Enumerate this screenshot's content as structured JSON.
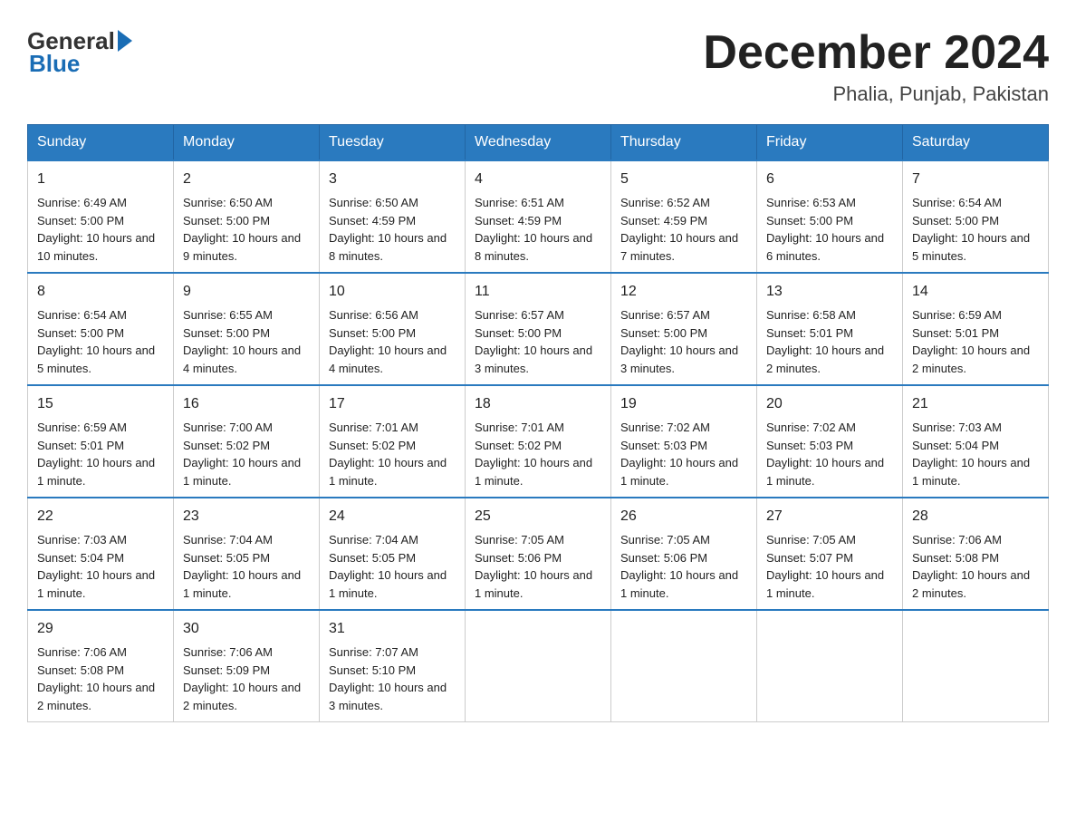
{
  "logo": {
    "general": "General",
    "blue": "Blue"
  },
  "title": "December 2024",
  "location": "Phalia, Punjab, Pakistan",
  "days_of_week": [
    "Sunday",
    "Monday",
    "Tuesday",
    "Wednesday",
    "Thursday",
    "Friday",
    "Saturday"
  ],
  "weeks": [
    [
      {
        "date": "1",
        "sunrise": "Sunrise: 6:49 AM",
        "sunset": "Sunset: 5:00 PM",
        "daylight": "Daylight: 10 hours and 10 minutes."
      },
      {
        "date": "2",
        "sunrise": "Sunrise: 6:50 AM",
        "sunset": "Sunset: 5:00 PM",
        "daylight": "Daylight: 10 hours and 9 minutes."
      },
      {
        "date": "3",
        "sunrise": "Sunrise: 6:50 AM",
        "sunset": "Sunset: 4:59 PM",
        "daylight": "Daylight: 10 hours and 8 minutes."
      },
      {
        "date": "4",
        "sunrise": "Sunrise: 6:51 AM",
        "sunset": "Sunset: 4:59 PM",
        "daylight": "Daylight: 10 hours and 8 minutes."
      },
      {
        "date": "5",
        "sunrise": "Sunrise: 6:52 AM",
        "sunset": "Sunset: 4:59 PM",
        "daylight": "Daylight: 10 hours and 7 minutes."
      },
      {
        "date": "6",
        "sunrise": "Sunrise: 6:53 AM",
        "sunset": "Sunset: 5:00 PM",
        "daylight": "Daylight: 10 hours and 6 minutes."
      },
      {
        "date": "7",
        "sunrise": "Sunrise: 6:54 AM",
        "sunset": "Sunset: 5:00 PM",
        "daylight": "Daylight: 10 hours and 5 minutes."
      }
    ],
    [
      {
        "date": "8",
        "sunrise": "Sunrise: 6:54 AM",
        "sunset": "Sunset: 5:00 PM",
        "daylight": "Daylight: 10 hours and 5 minutes."
      },
      {
        "date": "9",
        "sunrise": "Sunrise: 6:55 AM",
        "sunset": "Sunset: 5:00 PM",
        "daylight": "Daylight: 10 hours and 4 minutes."
      },
      {
        "date": "10",
        "sunrise": "Sunrise: 6:56 AM",
        "sunset": "Sunset: 5:00 PM",
        "daylight": "Daylight: 10 hours and 4 minutes."
      },
      {
        "date": "11",
        "sunrise": "Sunrise: 6:57 AM",
        "sunset": "Sunset: 5:00 PM",
        "daylight": "Daylight: 10 hours and 3 minutes."
      },
      {
        "date": "12",
        "sunrise": "Sunrise: 6:57 AM",
        "sunset": "Sunset: 5:00 PM",
        "daylight": "Daylight: 10 hours and 3 minutes."
      },
      {
        "date": "13",
        "sunrise": "Sunrise: 6:58 AM",
        "sunset": "Sunset: 5:01 PM",
        "daylight": "Daylight: 10 hours and 2 minutes."
      },
      {
        "date": "14",
        "sunrise": "Sunrise: 6:59 AM",
        "sunset": "Sunset: 5:01 PM",
        "daylight": "Daylight: 10 hours and 2 minutes."
      }
    ],
    [
      {
        "date": "15",
        "sunrise": "Sunrise: 6:59 AM",
        "sunset": "Sunset: 5:01 PM",
        "daylight": "Daylight: 10 hours and 1 minute."
      },
      {
        "date": "16",
        "sunrise": "Sunrise: 7:00 AM",
        "sunset": "Sunset: 5:02 PM",
        "daylight": "Daylight: 10 hours and 1 minute."
      },
      {
        "date": "17",
        "sunrise": "Sunrise: 7:01 AM",
        "sunset": "Sunset: 5:02 PM",
        "daylight": "Daylight: 10 hours and 1 minute."
      },
      {
        "date": "18",
        "sunrise": "Sunrise: 7:01 AM",
        "sunset": "Sunset: 5:02 PM",
        "daylight": "Daylight: 10 hours and 1 minute."
      },
      {
        "date": "19",
        "sunrise": "Sunrise: 7:02 AM",
        "sunset": "Sunset: 5:03 PM",
        "daylight": "Daylight: 10 hours and 1 minute."
      },
      {
        "date": "20",
        "sunrise": "Sunrise: 7:02 AM",
        "sunset": "Sunset: 5:03 PM",
        "daylight": "Daylight: 10 hours and 1 minute."
      },
      {
        "date": "21",
        "sunrise": "Sunrise: 7:03 AM",
        "sunset": "Sunset: 5:04 PM",
        "daylight": "Daylight: 10 hours and 1 minute."
      }
    ],
    [
      {
        "date": "22",
        "sunrise": "Sunrise: 7:03 AM",
        "sunset": "Sunset: 5:04 PM",
        "daylight": "Daylight: 10 hours and 1 minute."
      },
      {
        "date": "23",
        "sunrise": "Sunrise: 7:04 AM",
        "sunset": "Sunset: 5:05 PM",
        "daylight": "Daylight: 10 hours and 1 minute."
      },
      {
        "date": "24",
        "sunrise": "Sunrise: 7:04 AM",
        "sunset": "Sunset: 5:05 PM",
        "daylight": "Daylight: 10 hours and 1 minute."
      },
      {
        "date": "25",
        "sunrise": "Sunrise: 7:05 AM",
        "sunset": "Sunset: 5:06 PM",
        "daylight": "Daylight: 10 hours and 1 minute."
      },
      {
        "date": "26",
        "sunrise": "Sunrise: 7:05 AM",
        "sunset": "Sunset: 5:06 PM",
        "daylight": "Daylight: 10 hours and 1 minute."
      },
      {
        "date": "27",
        "sunrise": "Sunrise: 7:05 AM",
        "sunset": "Sunset: 5:07 PM",
        "daylight": "Daylight: 10 hours and 1 minute."
      },
      {
        "date": "28",
        "sunrise": "Sunrise: 7:06 AM",
        "sunset": "Sunset: 5:08 PM",
        "daylight": "Daylight: 10 hours and 2 minutes."
      }
    ],
    [
      {
        "date": "29",
        "sunrise": "Sunrise: 7:06 AM",
        "sunset": "Sunset: 5:08 PM",
        "daylight": "Daylight: 10 hours and 2 minutes."
      },
      {
        "date": "30",
        "sunrise": "Sunrise: 7:06 AM",
        "sunset": "Sunset: 5:09 PM",
        "daylight": "Daylight: 10 hours and 2 minutes."
      },
      {
        "date": "31",
        "sunrise": "Sunrise: 7:07 AM",
        "sunset": "Sunset: 5:10 PM",
        "daylight": "Daylight: 10 hours and 3 minutes."
      },
      null,
      null,
      null,
      null
    ]
  ]
}
